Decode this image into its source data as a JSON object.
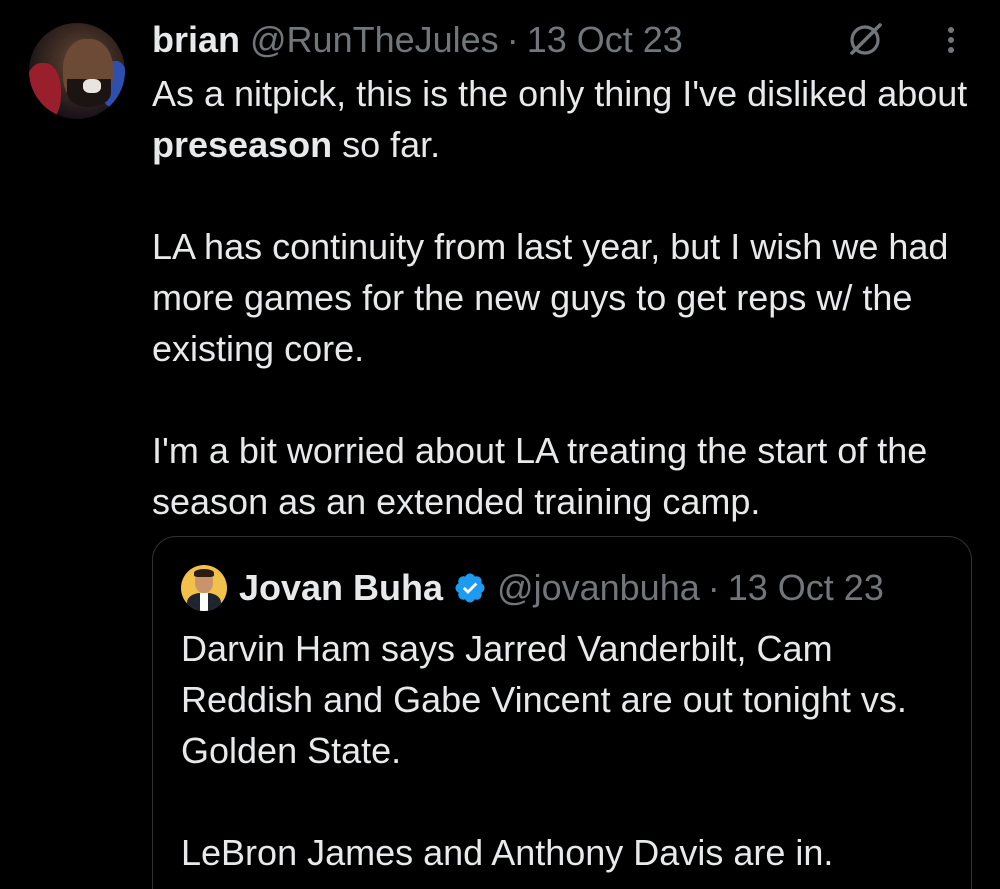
{
  "tweet": {
    "author_name": "brian",
    "author_handle": "@RunTheJules",
    "separator": "·",
    "date": "13 Oct 23",
    "body": {
      "p1_before": "As a nitpick, this is the only thing I've disliked about ",
      "p1_bold": "preseason",
      "p1_after": " so far.",
      "p2": "LA has continuity from last year, but I wish we had more games for the new guys to get reps w/ the existing core.",
      "p3": "I'm a bit worried about LA treating the start of the season as an extended training camp."
    }
  },
  "quoted_tweet": {
    "author_name": "Jovan Buha",
    "author_handle": "@jovanbuha",
    "separator": "·",
    "date": "13 Oct 23",
    "verified": true,
    "body": {
      "p1": "Darvin Ham says Jarred Vanderbilt, Cam Reddish and Gabe Vincent are out tonight vs. Golden State.",
      "p2": "LeBron James and Anthony Davis are in."
    }
  },
  "icons": {
    "grok": "grok-icon",
    "more": "more-options-icon",
    "verified": "verified-badge-icon"
  },
  "colors": {
    "background": "#000000",
    "text_primary": "#e7e9ea",
    "text_secondary": "#71767b",
    "border": "#2f3336",
    "verified_blue": "#1d9bf0"
  }
}
